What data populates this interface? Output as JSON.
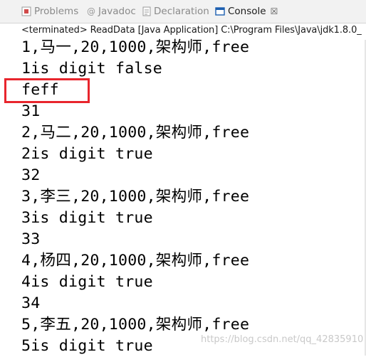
{
  "tabs": [
    {
      "label": "Problems",
      "icon": "problems-icon"
    },
    {
      "label": "Javadoc",
      "icon": "javadoc-icon"
    },
    {
      "label": "Declaration",
      "icon": "declaration-icon"
    },
    {
      "label": "Console",
      "icon": "console-icon",
      "active": true,
      "close": "☒"
    }
  ],
  "status": "<terminated> ReadData [Java Application] C:\\Program Files\\Java\\jdk1.8.0_",
  "console_lines": [
    "1,马一,20,1000,架构师,free",
    "1is digit false",
    "feff",
    "31",
    "2,马二,20,1000,架构师,free",
    "2is digit true",
    "32",
    "3,李三,20,1000,架构师,free",
    "3is digit true",
    "33",
    "4,杨四,20,1000,架构师,free",
    "4is digit true",
    "34",
    "5,李五,20,1000,架构师,free",
    "5is digit true"
  ],
  "watermark": "https://blog.csdn.net/qq_42835910",
  "colors": {
    "highlight_box": "#e8252d",
    "active_tab_icon": "#1c5fb0"
  }
}
